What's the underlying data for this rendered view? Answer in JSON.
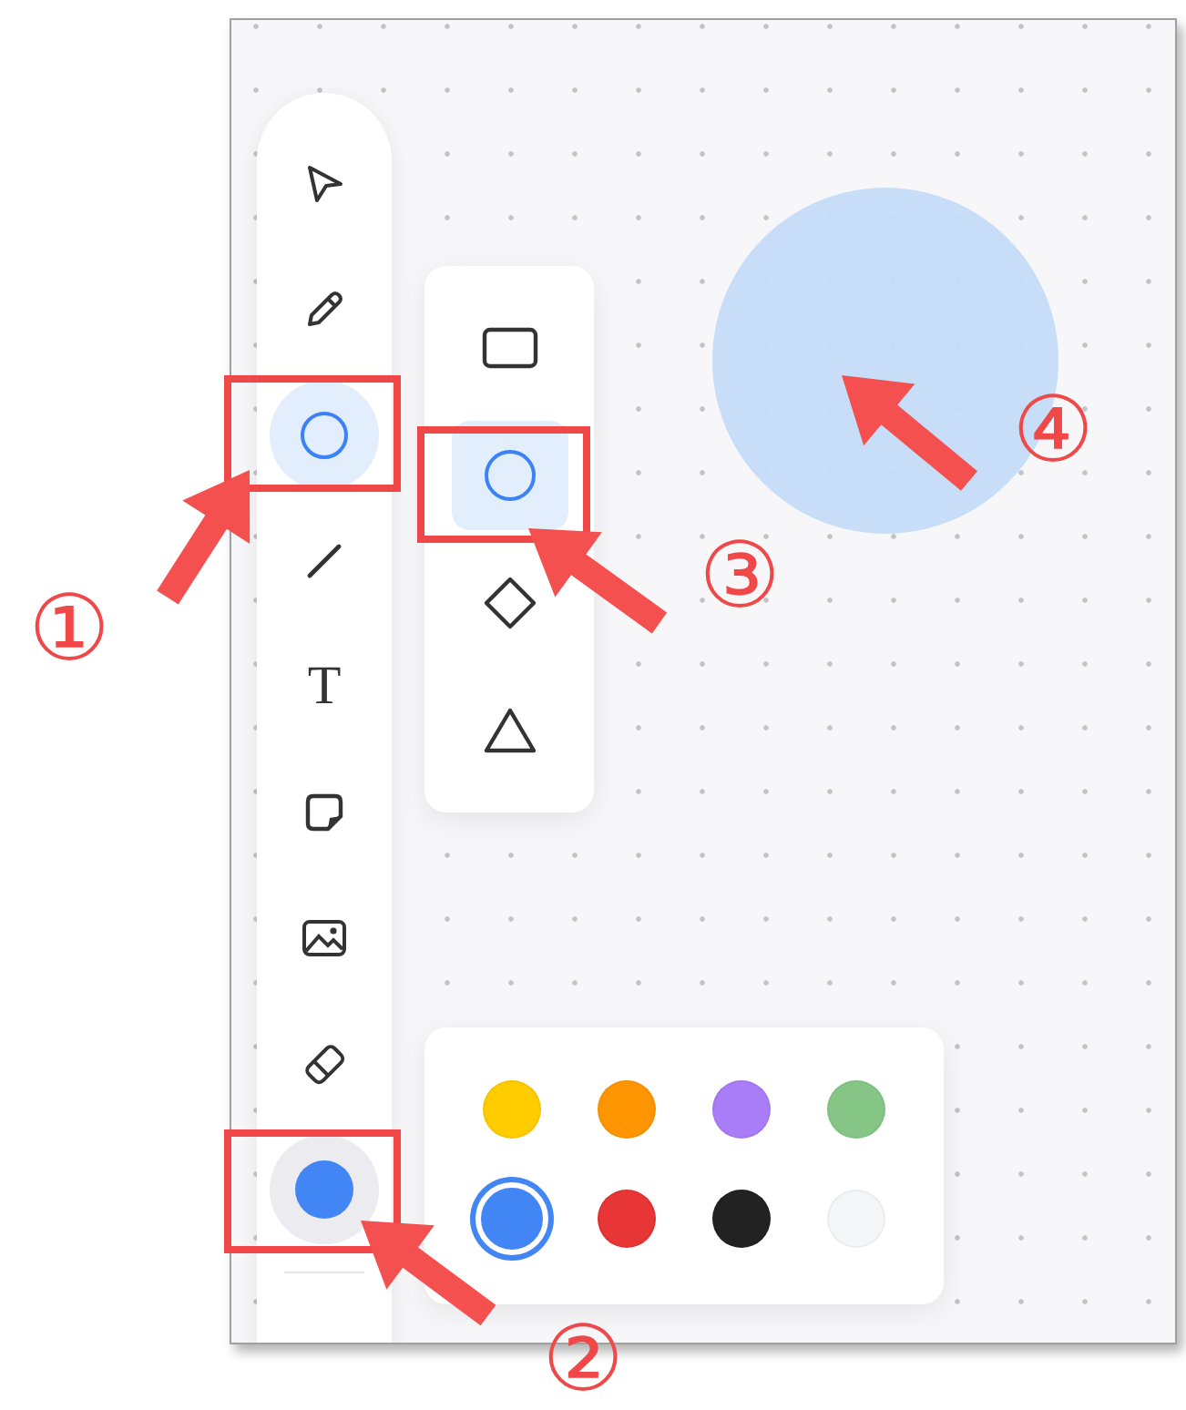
{
  "toolbar": {
    "tools": [
      {
        "kind": "select",
        "selected": false
      },
      {
        "kind": "pen",
        "selected": false
      },
      {
        "kind": "ellipse",
        "selected": true
      },
      {
        "kind": "line",
        "selected": false
      },
      {
        "kind": "text",
        "glyph": "T",
        "selected": false
      },
      {
        "kind": "note",
        "selected": false
      },
      {
        "kind": "image",
        "selected": false
      },
      {
        "kind": "eraser",
        "selected": false
      },
      {
        "kind": "color",
        "color": "#4285f4",
        "selected": false
      }
    ]
  },
  "shape_menu": {
    "shapes": [
      {
        "kind": "rectangle",
        "selected": false
      },
      {
        "kind": "ellipse",
        "selected": true
      },
      {
        "kind": "diamond",
        "selected": false
      },
      {
        "kind": "triangle",
        "selected": false
      }
    ]
  },
  "palette": {
    "colors": [
      {
        "color": "#ffcc00",
        "selected": false
      },
      {
        "color": "#ff9500",
        "selected": false
      },
      {
        "color": "#a97cf8",
        "selected": false
      },
      {
        "color": "#85c687",
        "selected": false
      },
      {
        "color": "#4285f4",
        "selected": true
      },
      {
        "color": "#e83535",
        "selected": false
      },
      {
        "color": "#222222",
        "selected": false
      },
      {
        "color": "#f5f6f8",
        "selected": false
      }
    ]
  },
  "canvas": {
    "shapes": [
      {
        "kind": "ellipse",
        "color": "#c5dcf8"
      }
    ]
  },
  "annotations": [
    {
      "label": "①"
    },
    {
      "label": "②"
    },
    {
      "label": "③"
    },
    {
      "label": "④"
    }
  ]
}
